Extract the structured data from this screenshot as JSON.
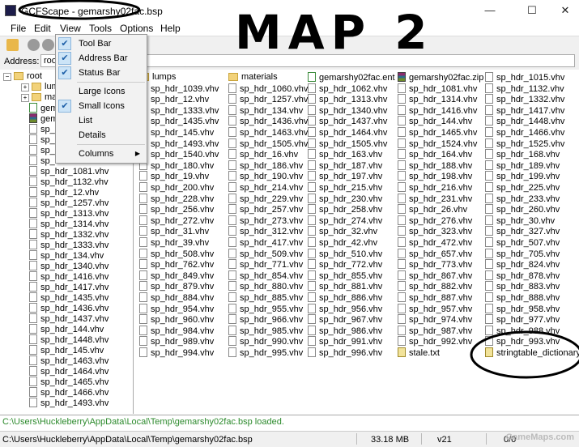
{
  "window": {
    "title": "GCFScape - gemarshy02fac.bsp",
    "buttons": {
      "minimize": "—",
      "maximize": "☐",
      "close": "✕"
    }
  },
  "menu": {
    "items": [
      "File",
      "Edit",
      "View",
      "Tools",
      "Options",
      "Help"
    ],
    "view_dropdown": {
      "items": [
        {
          "label": "Tool Bar",
          "checked": true
        },
        {
          "label": "Address Bar",
          "checked": true
        },
        {
          "label": "Status Bar",
          "checked": true
        },
        {
          "label": "Large Icons",
          "checked": false
        },
        {
          "label": "Small Icons",
          "checked": true
        },
        {
          "label": "List",
          "checked": false
        },
        {
          "label": "Details",
          "checked": false
        },
        {
          "label": "Columns",
          "checked": false,
          "submenu": true
        }
      ]
    }
  },
  "address": {
    "label": "Address:",
    "value": "root"
  },
  "tree": {
    "root": "root",
    "items": [
      {
        "label": "lump",
        "icon": "folder"
      },
      {
        "label": "mate",
        "icon": "folder"
      },
      {
        "label": "gem",
        "icon": "ent"
      },
      {
        "label": "gem",
        "icon": "zip"
      },
      {
        "label": "sp_",
        "icon": "file"
      },
      {
        "label": "sp_",
        "icon": "file"
      },
      {
        "label": "sp_",
        "icon": "file"
      },
      {
        "label": "sp_",
        "icon": "file"
      },
      {
        "label": "sp_hdr_1081.vhv",
        "icon": "file"
      },
      {
        "label": "sp_hdr_1132.vhv",
        "icon": "file"
      },
      {
        "label": "sp_hdr_12.vhv",
        "icon": "file"
      },
      {
        "label": "sp_hdr_1257.vhv",
        "icon": "file"
      },
      {
        "label": "sp_hdr_1313.vhv",
        "icon": "file"
      },
      {
        "label": "sp_hdr_1314.vhv",
        "icon": "file"
      },
      {
        "label": "sp_hdr_1332.vhv",
        "icon": "file"
      },
      {
        "label": "sp_hdr_1333.vhv",
        "icon": "file"
      },
      {
        "label": "sp_hdr_134.vhv",
        "icon": "file"
      },
      {
        "label": "sp_hdr_1340.vhv",
        "icon": "file"
      },
      {
        "label": "sp_hdr_1416.vhv",
        "icon": "file"
      },
      {
        "label": "sp_hdr_1417.vhv",
        "icon": "file"
      },
      {
        "label": "sp_hdr_1435.vhv",
        "icon": "file"
      },
      {
        "label": "sp_hdr_1436.vhv",
        "icon": "file"
      },
      {
        "label": "sp_hdr_1437.vhv",
        "icon": "file"
      },
      {
        "label": "sp_hdr_144.vhv",
        "icon": "file"
      },
      {
        "label": "sp_hdr_1448.vhv",
        "icon": "file"
      },
      {
        "label": "sp_hdr_145.vhv",
        "icon": "file"
      },
      {
        "label": "sp_hdr_1463.vhv",
        "icon": "file"
      },
      {
        "label": "sp_hdr_1464.vhv",
        "icon": "file"
      },
      {
        "label": "sp_hdr_1465.vhv",
        "icon": "file"
      },
      {
        "label": "sp_hdr_1466.vhv",
        "icon": "file"
      },
      {
        "label": "sp_hdr_1493.vhv",
        "icon": "file"
      }
    ]
  },
  "files": {
    "columns": [
      [
        {
          "label": "lumps",
          "icon": "folder"
        },
        {
          "label": "sp_hdr_1039.vhv"
        },
        {
          "label": "sp_hdr_12.vhv"
        },
        {
          "label": "sp_hdr_1333.vhv"
        },
        {
          "label": "sp_hdr_1435.vhv"
        },
        {
          "label": "sp_hdr_145.vhv"
        },
        {
          "label": "sp_hdr_1493.vhv"
        },
        {
          "label": "sp_hdr_1540.vhv"
        },
        {
          "label": "sp_hdr_180.vhv"
        },
        {
          "label": "sp_hdr_19.vhv"
        },
        {
          "label": "sp_hdr_200.vhv"
        },
        {
          "label": "sp_hdr_228.vhv"
        },
        {
          "label": "sp_hdr_256.vhv"
        },
        {
          "label": "sp_hdr_272.vhv"
        },
        {
          "label": "sp_hdr_31.vhv"
        },
        {
          "label": "sp_hdr_39.vhv"
        },
        {
          "label": "sp_hdr_508.vhv"
        },
        {
          "label": "sp_hdr_762.vhv"
        },
        {
          "label": "sp_hdr_849.vhv"
        },
        {
          "label": "sp_hdr_879.vhv"
        },
        {
          "label": "sp_hdr_884.vhv"
        },
        {
          "label": "sp_hdr_954.vhv"
        },
        {
          "label": "sp_hdr_960.vhv"
        },
        {
          "label": "sp_hdr_984.vhv"
        },
        {
          "label": "sp_hdr_989.vhv"
        },
        {
          "label": "sp_hdr_994.vhv"
        }
      ],
      [
        {
          "label": "materials",
          "icon": "folder"
        },
        {
          "label": "sp_hdr_1060.vhv"
        },
        {
          "label": "sp_hdr_1257.vhv"
        },
        {
          "label": "sp_hdr_134.vhv"
        },
        {
          "label": "sp_hdr_1436.vhv"
        },
        {
          "label": "sp_hdr_1463.vhv"
        },
        {
          "label": "sp_hdr_1505.vhv"
        },
        {
          "label": "sp_hdr_16.vhv"
        },
        {
          "label": "sp_hdr_186.vhv"
        },
        {
          "label": "sp_hdr_190.vhv"
        },
        {
          "label": "sp_hdr_214.vhv"
        },
        {
          "label": "sp_hdr_229.vhv"
        },
        {
          "label": "sp_hdr_257.vhv"
        },
        {
          "label": "sp_hdr_273.vhv"
        },
        {
          "label": "sp_hdr_312.vhv"
        },
        {
          "label": "sp_hdr_417.vhv"
        },
        {
          "label": "sp_hdr_509.vhv"
        },
        {
          "label": "sp_hdr_771.vhv"
        },
        {
          "label": "sp_hdr_854.vhv"
        },
        {
          "label": "sp_hdr_880.vhv"
        },
        {
          "label": "sp_hdr_885.vhv"
        },
        {
          "label": "sp_hdr_955.vhv"
        },
        {
          "label": "sp_hdr_966.vhv"
        },
        {
          "label": "sp_hdr_985.vhv"
        },
        {
          "label": "sp_hdr_990.vhv"
        },
        {
          "label": "sp_hdr_995.vhv"
        }
      ],
      [
        {
          "label": "gemarshy02fac.ent",
          "icon": "ent"
        },
        {
          "label": "sp_hdr_1062.vhv"
        },
        {
          "label": "sp_hdr_1313.vhv"
        },
        {
          "label": "sp_hdr_1340.vhv"
        },
        {
          "label": "sp_hdr_1437.vhv"
        },
        {
          "label": "sp_hdr_1464.vhv"
        },
        {
          "label": "sp_hdr_1505.vhv"
        },
        {
          "label": "sp_hdr_163.vhv"
        },
        {
          "label": "sp_hdr_187.vhv"
        },
        {
          "label": "sp_hdr_197.vhv"
        },
        {
          "label": "sp_hdr_215.vhv"
        },
        {
          "label": "sp_hdr_230.vhv"
        },
        {
          "label": "sp_hdr_258.vhv"
        },
        {
          "label": "sp_hdr_274.vhv"
        },
        {
          "label": "sp_hdr_32.vhv"
        },
        {
          "label": "sp_hdr_42.vhv"
        },
        {
          "label": "sp_hdr_510.vhv"
        },
        {
          "label": "sp_hdr_772.vhv"
        },
        {
          "label": "sp_hdr_855.vhv"
        },
        {
          "label": "sp_hdr_881.vhv"
        },
        {
          "label": "sp_hdr_886.vhv"
        },
        {
          "label": "sp_hdr_956.vhv"
        },
        {
          "label": "sp_hdr_967.vhv"
        },
        {
          "label": "sp_hdr_986.vhv"
        },
        {
          "label": "sp_hdr_991.vhv"
        },
        {
          "label": "sp_hdr_996.vhv"
        }
      ],
      [
        {
          "label": "gemarshy02fac.zip",
          "icon": "zip"
        },
        {
          "label": "sp_hdr_1081.vhv"
        },
        {
          "label": "sp_hdr_1314.vhv"
        },
        {
          "label": "sp_hdr_1416.vhv"
        },
        {
          "label": "sp_hdr_144.vhv"
        },
        {
          "label": "sp_hdr_1465.vhv"
        },
        {
          "label": "sp_hdr_1524.vhv"
        },
        {
          "label": "sp_hdr_164.vhv"
        },
        {
          "label": "sp_hdr_188.vhv"
        },
        {
          "label": "sp_hdr_198.vhv"
        },
        {
          "label": "sp_hdr_216.vhv"
        },
        {
          "label": "sp_hdr_231.vhv"
        },
        {
          "label": "sp_hdr_26.vhv"
        },
        {
          "label": "sp_hdr_276.vhv"
        },
        {
          "label": "sp_hdr_323.vhv"
        },
        {
          "label": "sp_hdr_472.vhv"
        },
        {
          "label": "sp_hdr_657.vhv"
        },
        {
          "label": "sp_hdr_773.vhv"
        },
        {
          "label": "sp_hdr_867.vhv"
        },
        {
          "label": "sp_hdr_882.vhv"
        },
        {
          "label": "sp_hdr_887.vhv"
        },
        {
          "label": "sp_hdr_957.vhv"
        },
        {
          "label": "sp_hdr_974.vhv"
        },
        {
          "label": "sp_hdr_987.vhv"
        },
        {
          "label": "sp_hdr_992.vhv"
        },
        {
          "label": "stale.txt",
          "icon": "txt"
        }
      ],
      [
        {
          "label": "sp_hdr_1015.vhv"
        },
        {
          "label": "sp_hdr_1132.vhv"
        },
        {
          "label": "sp_hdr_1332.vhv"
        },
        {
          "label": "sp_hdr_1417.vhv"
        },
        {
          "label": "sp_hdr_1448.vhv"
        },
        {
          "label": "sp_hdr_1466.vhv"
        },
        {
          "label": "sp_hdr_1525.vhv"
        },
        {
          "label": "sp_hdr_168.vhv"
        },
        {
          "label": "sp_hdr_189.vhv"
        },
        {
          "label": "sp_hdr_199.vhv"
        },
        {
          "label": "sp_hdr_225.vhv"
        },
        {
          "label": "sp_hdr_233.vhv"
        },
        {
          "label": "sp_hdr_260.vhv"
        },
        {
          "label": "sp_hdr_30.vhv"
        },
        {
          "label": "sp_hdr_327.vhv"
        },
        {
          "label": "sp_hdr_507.vhv"
        },
        {
          "label": "sp_hdr_705.vhv"
        },
        {
          "label": "sp_hdr_824.vhv"
        },
        {
          "label": "sp_hdr_878.vhv"
        },
        {
          "label": "sp_hdr_883.vhv"
        },
        {
          "label": "sp_hdr_888.vhv"
        },
        {
          "label": "sp_hdr_958.vhv"
        },
        {
          "label": "sp_hdr_977.vhv"
        },
        {
          "label": "sp_hdr_988.vhv"
        },
        {
          "label": "sp_hdr_993.vhv"
        },
        {
          "label": "stringtable_dictionary.dct",
          "icon": "txt"
        }
      ]
    ]
  },
  "log": {
    "message": "C:\\Users\\Huckleberry\\AppData\\Local\\Temp\\gemarshy02fac.bsp loaded."
  },
  "status": {
    "path": "C:\\Users\\Huckleberry\\AppData\\Local\\Temp\\gemarshy02fac.bsp",
    "size": "33.18 MB",
    "version": "v21",
    "count": "0/0"
  },
  "annotation": {
    "text": "MAP 2"
  },
  "watermark": {
    "text": "GameMaps.com"
  }
}
